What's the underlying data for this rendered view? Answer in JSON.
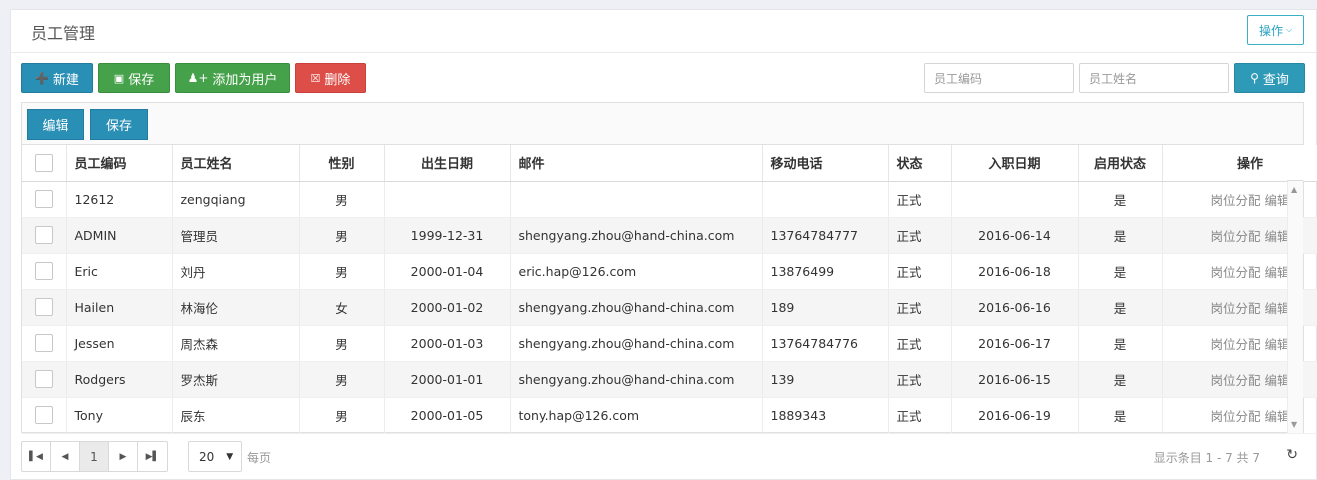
{
  "header": {
    "title": "员工管理",
    "ops_label": "操作"
  },
  "toolbar": {
    "new_label": "新建",
    "save_label": "保存",
    "add_user_label": "添加为用户",
    "delete_label": "删除",
    "search_code_placeholder": "员工编码",
    "search_name_placeholder": "员工姓名",
    "search_label": "查询"
  },
  "grid_toolbar": {
    "edit_label": "编辑",
    "save_label": "保存"
  },
  "columns": [
    "员工编码",
    "员工姓名",
    "性别",
    "出生日期",
    "邮件",
    "移动电话",
    "状态",
    "入职日期",
    "启用状态",
    "操作"
  ],
  "rows": [
    {
      "code": "12612",
      "name": "zengqiang",
      "gender": "男",
      "birth": "",
      "email": "",
      "phone": "",
      "status": "正式",
      "hire": "",
      "enabled": "是"
    },
    {
      "code": "ADMIN",
      "name": "管理员",
      "gender": "男",
      "birth": "1999-12-31",
      "email": "shengyang.zhou@hand-china.com",
      "phone": "13764784777",
      "status": "正式",
      "hire": "2016-06-14",
      "enabled": "是"
    },
    {
      "code": "Eric",
      "name": "刘丹",
      "gender": "男",
      "birth": "2000-01-04",
      "email": "eric.hap@126.com",
      "phone": "13876499",
      "status": "正式",
      "hire": "2016-06-18",
      "enabled": "是"
    },
    {
      "code": "Hailen",
      "name": "林海伦",
      "gender": "女",
      "birth": "2000-01-02",
      "email": "shengyang.zhou@hand-china.com",
      "phone": "189",
      "status": "正式",
      "hire": "2016-06-16",
      "enabled": "是"
    },
    {
      "code": "Jessen",
      "name": "周杰森",
      "gender": "男",
      "birth": "2000-01-03",
      "email": "shengyang.zhou@hand-china.com",
      "phone": "13764784776",
      "status": "正式",
      "hire": "2016-06-17",
      "enabled": "是"
    },
    {
      "code": "Rodgers",
      "name": "罗杰斯",
      "gender": "男",
      "birth": "2000-01-01",
      "email": "shengyang.zhou@hand-china.com",
      "phone": "139",
      "status": "正式",
      "hire": "2016-06-15",
      "enabled": "是"
    },
    {
      "code": "Tony",
      "name": "辰东",
      "gender": "男",
      "birth": "2000-01-05",
      "email": "tony.hap@126.com",
      "phone": "1889343",
      "status": "正式",
      "hire": "2016-06-19",
      "enabled": "是"
    }
  ],
  "row_actions": {
    "assign_label": "岗位分配",
    "edit_label": "编辑"
  },
  "pager": {
    "current_page": "1",
    "page_size": "20",
    "per_page_label": "每页",
    "summary": "显示条目 1 - 7 共 7"
  },
  "icons": [
    "plus-square-icon",
    "floppy-icon",
    "user-plus-icon",
    "trash-icon",
    "search-icon",
    "chevron-down-icon",
    "first-page-icon",
    "prev-page-icon",
    "next-page-icon",
    "last-page-icon",
    "refresh-icon"
  ]
}
